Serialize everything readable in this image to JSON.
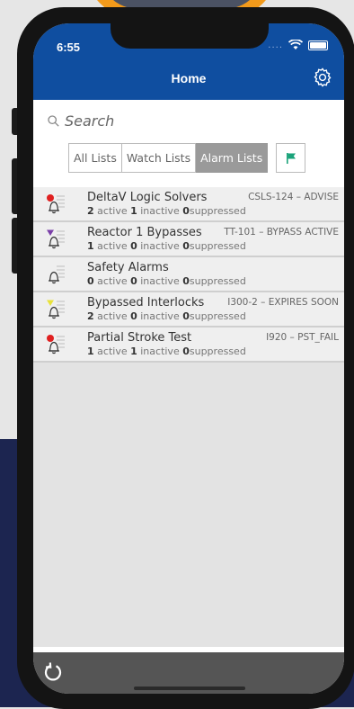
{
  "status": {
    "time": "6:55",
    "dots": "...."
  },
  "nav": {
    "title": "Home"
  },
  "search": {
    "placeholder": "Search"
  },
  "tabs": [
    {
      "label": "All Lists",
      "active": false
    },
    {
      "label": "Watch Lists",
      "active": false
    },
    {
      "label": "Alarm Lists",
      "active": true
    }
  ],
  "flag_color": "#1aa37a",
  "alarm_lists": [
    {
      "name": "DeltaV Logic Solvers",
      "code": "CSLS-124 – ADVISE",
      "active": "2",
      "inactive": "1",
      "suppressed": "0",
      "priority_color": "#e02020",
      "priority_shape": "dot"
    },
    {
      "name": "Reactor 1 Bypasses",
      "code": "TT-101 – BYPASS ACTIVE",
      "active": "1",
      "inactive": "0",
      "suppressed": "0",
      "priority_color": "#7a3fa8",
      "priority_shape": "triangle"
    },
    {
      "name": "Safety Alarms",
      "code": "",
      "active": "0",
      "inactive": "0",
      "suppressed": "0",
      "priority_color": "",
      "priority_shape": "none"
    },
    {
      "name": "Bypassed Interlocks",
      "code": "I300-2 – EXPIRES SOON",
      "active": "2",
      "inactive": "0",
      "suppressed": "0",
      "priority_color": "#e8e23a",
      "priority_shape": "triangle"
    },
    {
      "name": "Partial Stroke Test",
      "code": "I920 – PST_FAIL",
      "active": "1",
      "inactive": "1",
      "suppressed": "0",
      "priority_color": "#e02020",
      "priority_shape": "dot"
    }
  ],
  "labels": {
    "active": "active",
    "inactive": "inactive",
    "suppressed": "suppressed"
  },
  "colors": {
    "header": "#0f4ea0",
    "navy": "#1c2550",
    "accent": "#f29a1b"
  }
}
